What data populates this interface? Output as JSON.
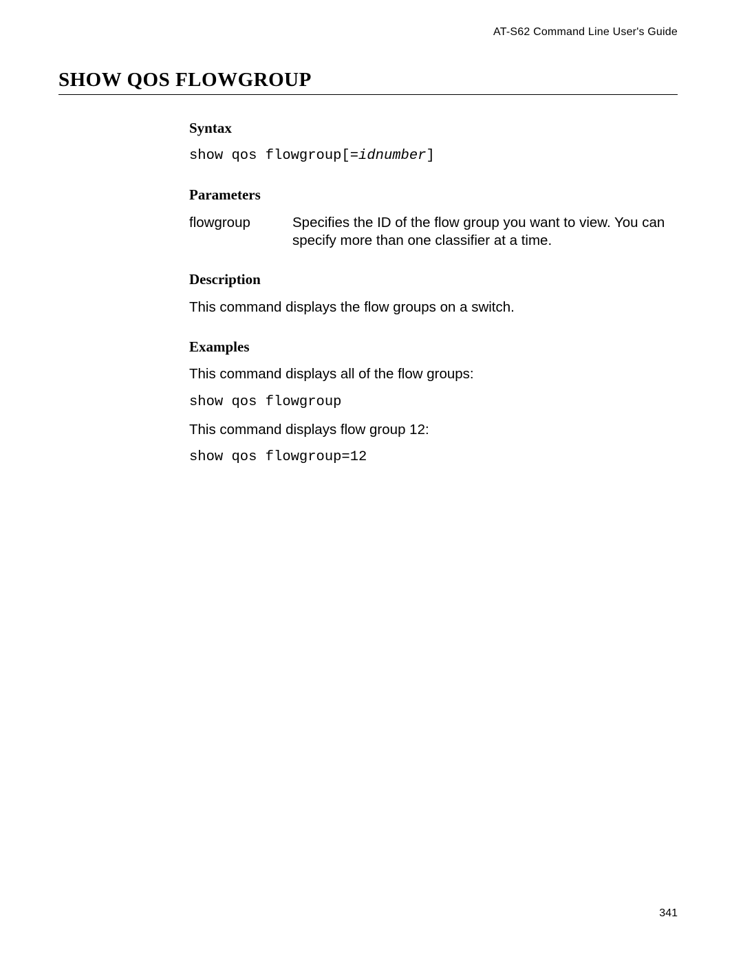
{
  "running_head": "AT-S62 Command Line User's Guide",
  "title": "SHOW QOS FLOWGROUP",
  "sections": {
    "syntax": {
      "heading": "Syntax",
      "code_prefix": "show qos flowgroup[=",
      "code_var": "idnumber",
      "code_suffix": "]"
    },
    "parameters": {
      "heading": "Parameters",
      "items": [
        {
          "term": "flowgroup",
          "def": "Specifies the ID of the flow group you want to view. You can specify more than one classifier at a time."
        }
      ]
    },
    "description": {
      "heading": "Description",
      "text": "This command displays the flow groups on a switch."
    },
    "examples": {
      "heading": "Examples",
      "intro1": "This command displays all of the flow groups:",
      "code1": "show qos flowgroup",
      "intro2": "This command displays flow group 12:",
      "code2": "show qos flowgroup=12"
    }
  },
  "page_number": "341"
}
